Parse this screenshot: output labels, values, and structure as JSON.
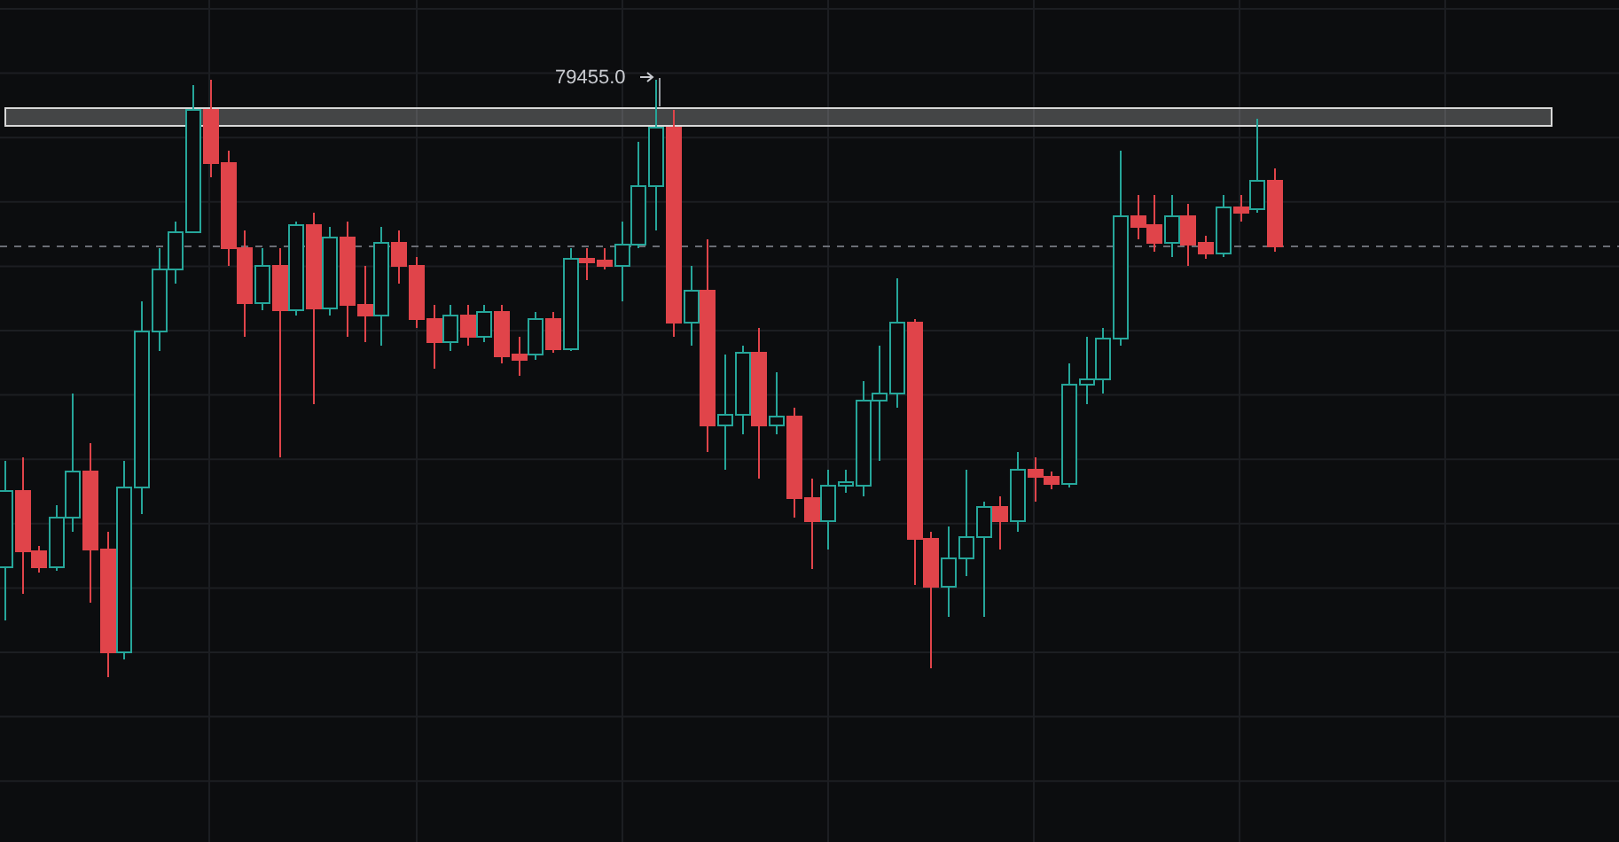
{
  "chart": {
    "price_label": "79455.0"
  }
}
